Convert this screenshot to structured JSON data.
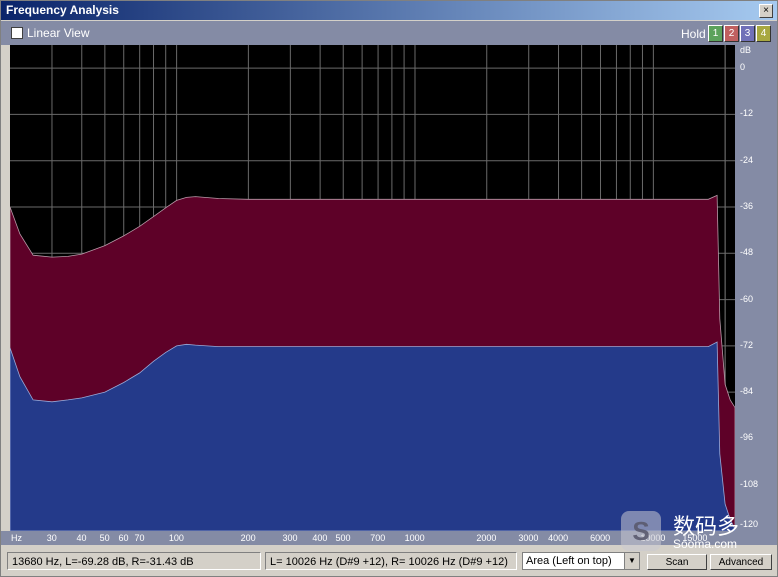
{
  "window": {
    "title": "Frequency Analysis",
    "close_glyph": "×"
  },
  "toolbar": {
    "linear_view_label": "Linear View",
    "hold_label": "Hold",
    "hold_buttons": [
      {
        "label": "1",
        "color": "#5ca25c"
      },
      {
        "label": "2",
        "color": "#c06060"
      },
      {
        "label": "3",
        "color": "#7070b8"
      },
      {
        "label": "4",
        "color": "#a8a840"
      }
    ]
  },
  "chart_data": {
    "type": "area",
    "x_scale": "log",
    "xlim": [
      20,
      22000
    ],
    "ylim": [
      -120,
      6
    ],
    "ylabel": "dB",
    "xlabel": "Hz",
    "y_ticks": [
      "dB",
      "0",
      "-12",
      "-24",
      "-36",
      "-48",
      "-60",
      "-72",
      "-84",
      "-96",
      "-108",
      "-120"
    ],
    "x_ticks": [
      "30",
      "40",
      "50",
      "60",
      "70",
      "100",
      "200",
      "300",
      "400",
      "500",
      "700",
      "1000",
      "2000",
      "3000",
      "4000",
      "6000",
      "10000",
      "15000"
    ],
    "x_tick_values": [
      30,
      40,
      50,
      60,
      70,
      100,
      200,
      300,
      400,
      500,
      700,
      1000,
      2000,
      3000,
      4000,
      6000,
      10000,
      15000
    ],
    "series": [
      {
        "color": "#5e0128",
        "x": [
          20,
          22,
          25,
          30,
          35,
          40,
          50,
          60,
          70,
          80,
          90,
          100,
          110,
          120,
          150,
          200,
          500,
          1000,
          5000,
          10000,
          15000,
          17000,
          18500,
          19000,
          20000,
          21000,
          22000
        ],
        "values": [
          -36,
          -43,
          -48.5,
          -49,
          -48.8,
          -48.2,
          -46,
          -43.5,
          -41,
          -38.5,
          -36.2,
          -34.3,
          -33.5,
          -33.3,
          -33.8,
          -34,
          -34,
          -34,
          -34,
          -34,
          -34,
          -34,
          -33,
          -65,
          -82,
          -86,
          -88
        ]
      },
      {
        "color": "#243a8a",
        "x": [
          20,
          22,
          25,
          30,
          35,
          40,
          50,
          60,
          70,
          80,
          90,
          100,
          110,
          120,
          150,
          200,
          500,
          1000,
          5000,
          10000,
          15000,
          17000,
          18500,
          19000,
          20000,
          21000,
          22000
        ],
        "values": [
          -72.5,
          -80,
          -86,
          -86.5,
          -86,
          -85.5,
          -84,
          -81.5,
          -79,
          -76,
          -73.7,
          -72,
          -71.6,
          -71.8,
          -72.2,
          -72.2,
          -72.2,
          -72.2,
          -72.2,
          -72.2,
          -72.2,
          -72.2,
          -71,
          -100,
          -113,
          -117,
          -119.5
        ]
      }
    ]
  },
  "status": {
    "cursor_readout": "13680 Hz, L=-69.28 dB, R=-31.43 dB",
    "peak_readout": "L=  10026 Hz (D#9 +12), R=  10026 Hz (D#9 +12)",
    "mode_selected": "Area (Left on top)",
    "scan_button": "Scan",
    "advanced_button": "Advanced"
  },
  "watermark": {
    "logo": "S",
    "text_cn": "数码多",
    "text_en": "Sooma.com"
  },
  "icons": {
    "dropdown": "chevron-down-icon",
    "checkbox": "checkbox-icon"
  }
}
